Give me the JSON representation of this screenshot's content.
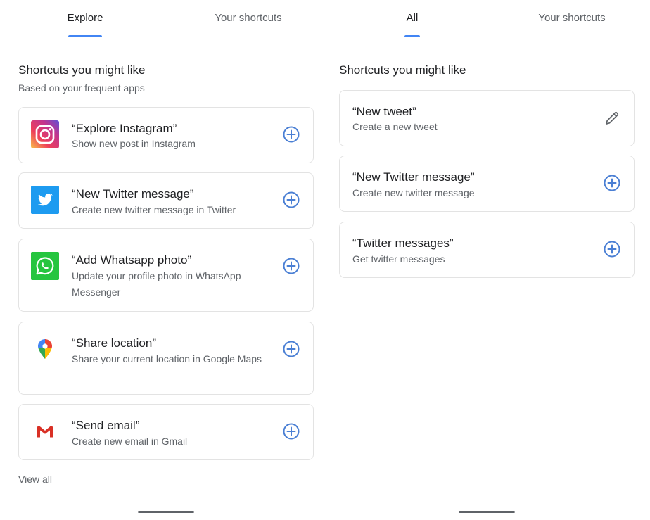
{
  "left_screen": {
    "tabs": [
      {
        "label": "Explore",
        "active": true
      },
      {
        "label": "Your shortcuts",
        "active": false
      }
    ],
    "section_title": "Shortcuts you might like",
    "section_subtitle": "Based on your frequent apps",
    "cards": [
      {
        "title": "“Explore Instagram”",
        "description": "Show new post in Instagram",
        "app_icon": "instagram-icon",
        "action_icon": "add-circle-icon"
      },
      {
        "title": "“New Twitter message”",
        "description": "Create new twitter message in Twitter",
        "app_icon": "twitter-icon",
        "action_icon": "add-circle-icon"
      },
      {
        "title": "“Add Whatsapp photo”",
        "description": "Update your profile photo in WhatsApp Messenger",
        "app_icon": "whatsapp-icon",
        "action_icon": "add-circle-icon"
      },
      {
        "title": "“Share location”",
        "description": "Share your current location in Google Maps",
        "app_icon": "google-maps-icon",
        "action_icon": "add-circle-icon"
      },
      {
        "title": "“Send email”",
        "description": "Create new email in Gmail",
        "app_icon": "gmail-icon",
        "action_icon": "add-circle-icon"
      }
    ],
    "view_all_label": "View all"
  },
  "right_screen": {
    "tabs": [
      {
        "label": "All",
        "active": true
      },
      {
        "label": "Your shortcuts",
        "active": false
      }
    ],
    "section_title": "Shortcuts you might like",
    "cards": [
      {
        "title": "“New tweet”",
        "description": "Create a new tweet",
        "action_icon": "edit-pencil-icon"
      },
      {
        "title": "“New Twitter message”",
        "description": "Create new twitter message",
        "action_icon": "add-circle-icon"
      },
      {
        "title": "“Twitter messages”",
        "description": "Get twitter messages",
        "action_icon": "add-circle-icon"
      }
    ]
  },
  "colors": {
    "accent": "#4285f4",
    "add_icon": "#4a7fd4",
    "text_primary": "#202124",
    "text_secondary": "#5f6368",
    "card_border": "#e3e3e3"
  }
}
